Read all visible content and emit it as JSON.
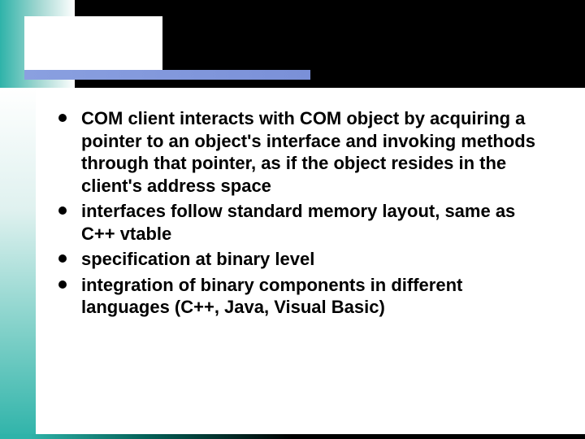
{
  "bullets": [
    "COM client interacts with COM object by acquiring a pointer to an object's interface and invoking methods through that pointer, as if the object resides in the client's address space",
    "interfaces follow standard memory layout, same as C++ vtable",
    "specification at binary level",
    "integration of binary components in different languages (C++, Java, Visual Basic)"
  ]
}
